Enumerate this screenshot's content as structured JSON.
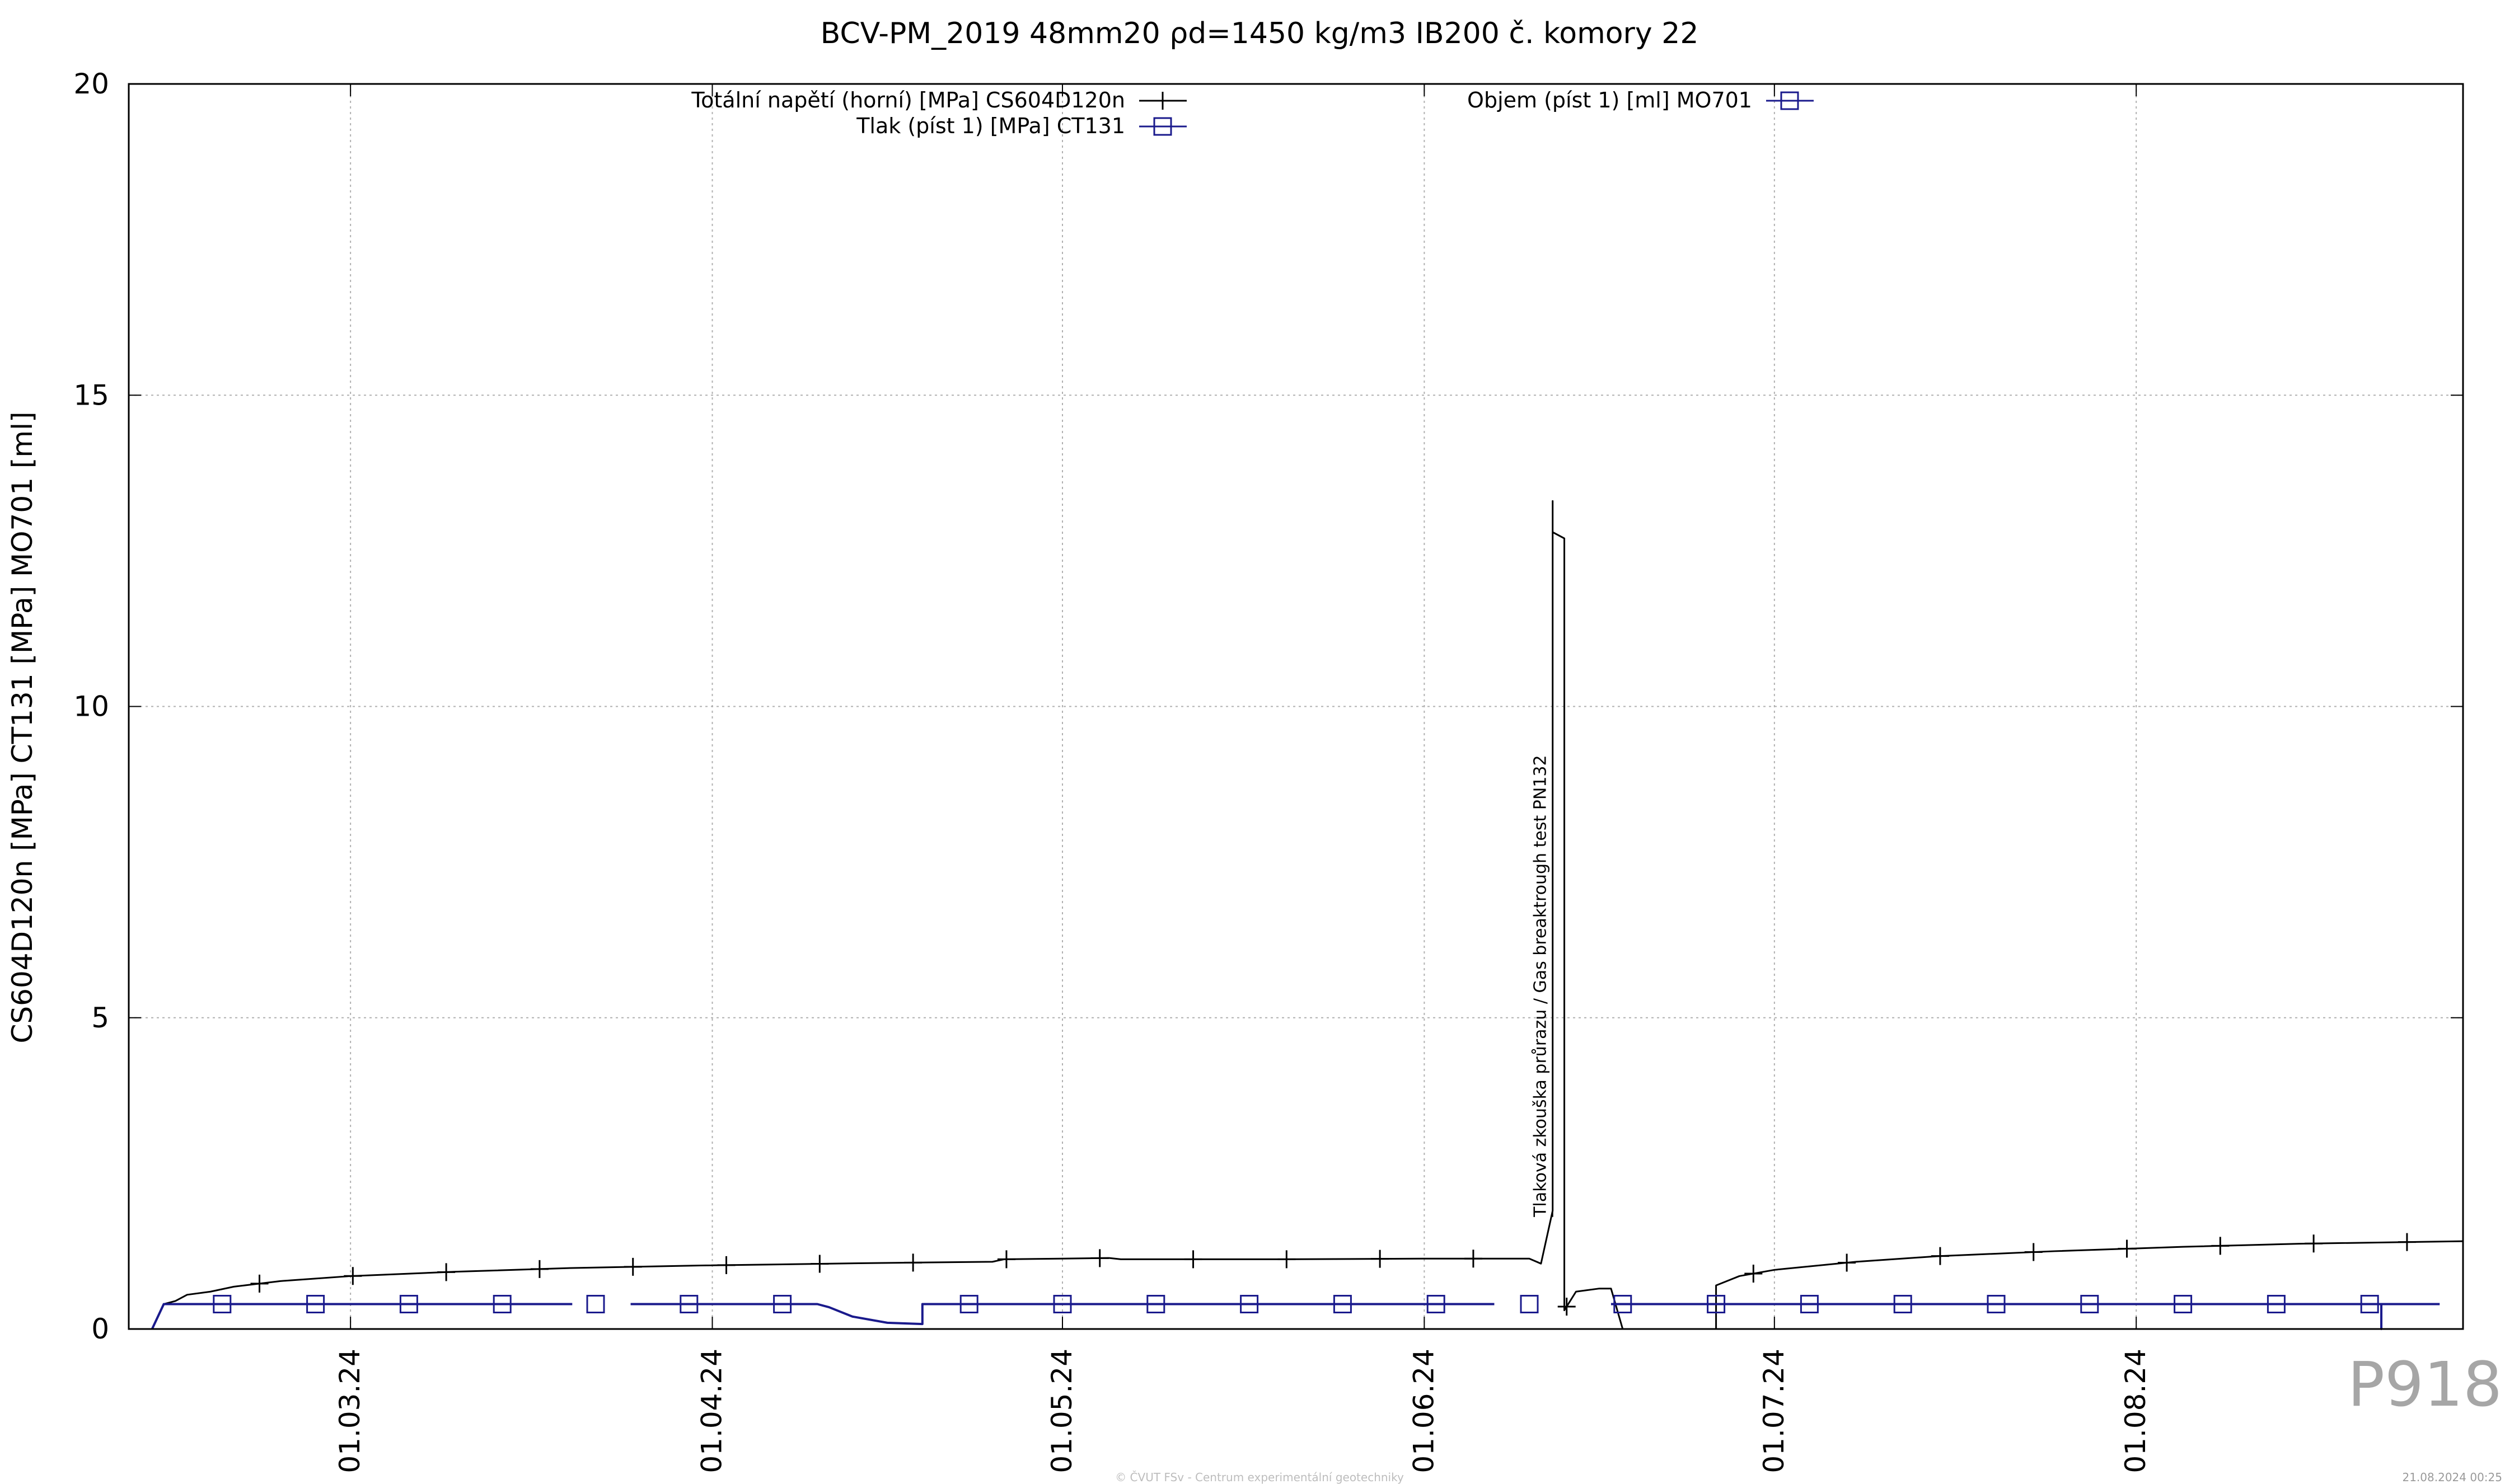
{
  "chart_data": {
    "type": "line",
    "title": "BCV-PM_2019 48mm20 ρd=1450 kg/m3 IB200 č. komory 22",
    "ylabel": "CS604D120n [MPa] CT131 [MPa] MO701 [ml]",
    "xlabel": "",
    "ylim": [
      0,
      20
    ],
    "xlim": [
      "2024-02-11",
      "2024-08-29"
    ],
    "y_ticks": [
      "0",
      "5",
      "10",
      "15",
      "20"
    ],
    "y_tick_values": [
      0,
      5,
      10,
      15,
      20
    ],
    "x_ticks": [
      "01.03.24",
      "01.04.24",
      "01.05.24",
      "01.06.24",
      "01.07.24",
      "01.08.24"
    ],
    "x_tick_dates": [
      "2024-03-01",
      "2024-04-01",
      "2024-05-01",
      "2024-06-01",
      "2024-07-01",
      "2024-08-01"
    ],
    "grid": true,
    "legend_position": "top",
    "annotation": {
      "text": "Tlaková zkouška průrazu / Gas breaktrough test PN132",
      "date": "2024-06-12",
      "y": 1.8
    },
    "series": [
      {
        "name": "Totální napětí (horní) [MPa] CS604D120n",
        "color": "#000000",
        "marker": "plus",
        "points": [
          [
            "2024-02-13",
            0.0
          ],
          [
            "2024-02-14",
            0.4
          ],
          [
            "2024-02-15",
            0.45
          ],
          [
            "2024-02-16",
            0.55
          ],
          [
            "2024-02-18",
            0.6
          ],
          [
            "2024-02-20",
            0.68
          ],
          [
            "2024-02-24",
            0.77
          ],
          [
            "2024-03-01",
            0.85
          ],
          [
            "2024-03-10",
            0.92
          ],
          [
            "2024-03-20",
            0.98
          ],
          [
            "2024-03-31",
            1.02
          ],
          [
            "2024-04-15",
            1.06
          ],
          [
            "2024-04-25",
            1.08
          ],
          [
            "2024-04-26",
            1.12
          ],
          [
            "2024-05-05",
            1.14
          ],
          [
            "2024-05-06",
            1.12
          ],
          [
            "2024-05-20",
            1.12
          ],
          [
            "2024-06-01",
            1.13
          ],
          [
            "2024-06-10",
            1.13
          ],
          [
            "2024-06-11",
            1.05
          ],
          [
            "2024-06-12",
            1.9
          ],
          [
            "2024-06-12",
            13.3
          ],
          [
            "2024-06-12",
            12.8
          ],
          [
            "2024-06-13",
            12.7
          ],
          [
            "2024-06-13",
            0.3
          ],
          [
            "2024-06-14",
            0.6
          ],
          [
            "2024-06-16",
            0.65
          ],
          [
            "2024-06-17",
            0.65
          ],
          [
            "2024-06-18",
            0.0
          ],
          [
            "2024-06-26",
            0.0
          ],
          [
            "2024-06-26",
            0.7
          ],
          [
            "2024-06-28",
            0.85
          ],
          [
            "2024-07-01",
            0.95
          ],
          [
            "2024-07-08",
            1.08
          ],
          [
            "2024-07-15",
            1.17
          ],
          [
            "2024-07-25",
            1.25
          ],
          [
            "2024-08-05",
            1.32
          ],
          [
            "2024-08-15",
            1.37
          ],
          [
            "2024-08-29",
            1.41
          ]
        ]
      },
      {
        "name": "Tlak (píst 1) [MPa] CT131",
        "color": "#1a1a8c",
        "marker": "square",
        "points": [
          [
            "2024-02-13",
            0.0
          ],
          [
            "2024-02-14",
            0.4
          ],
          [
            "2024-03-20",
            0.4
          ],
          [
            "2024-03-20",
            null
          ],
          [
            "2024-03-25",
            0.4
          ],
          [
            "2024-04-10",
            0.4
          ],
          [
            "2024-04-11",
            0.35
          ],
          [
            "2024-04-13",
            0.2
          ],
          [
            "2024-04-16",
            0.1
          ],
          [
            "2024-04-19",
            0.08
          ],
          [
            "2024-04-19",
            0.4
          ],
          [
            "2024-06-07",
            0.4
          ],
          [
            "2024-06-07",
            null
          ],
          [
            "2024-06-17",
            0.4
          ],
          [
            "2024-08-22",
            0.4
          ],
          [
            "2024-08-22",
            0.0
          ],
          [
            "2024-08-22",
            0.4
          ],
          [
            "2024-08-27",
            0.4
          ]
        ]
      },
      {
        "name": "Objem (píst 1) [ml] MO701",
        "color": "#1a1a8c",
        "marker": "square",
        "points": []
      }
    ]
  },
  "watermark": "P918",
  "footer": "© ČVUT FSv - Centrum experimentální geotechniky",
  "timestamp": "21.08.2024 00:25"
}
